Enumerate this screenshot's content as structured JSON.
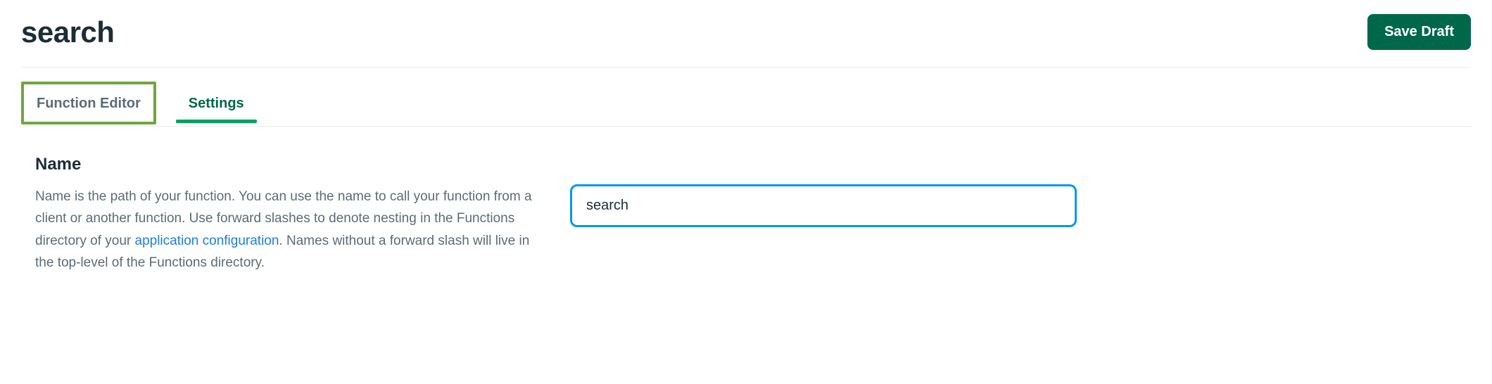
{
  "header": {
    "title": "search",
    "save_button_label": "Save Draft"
  },
  "tabs": {
    "function_editor": "Function Editor",
    "settings": "Settings"
  },
  "settings_section": {
    "name_field": {
      "label": "Name",
      "description_part1": "Name is the path of your function. You can use the name to call your function from a client or another function. Use forward slashes to denote nesting in the Functions directory of your ",
      "description_link": "application configuration",
      "description_part2": ". Names without a forward slash will live in the top-level of the Functions directory.",
      "value": "search"
    }
  }
}
